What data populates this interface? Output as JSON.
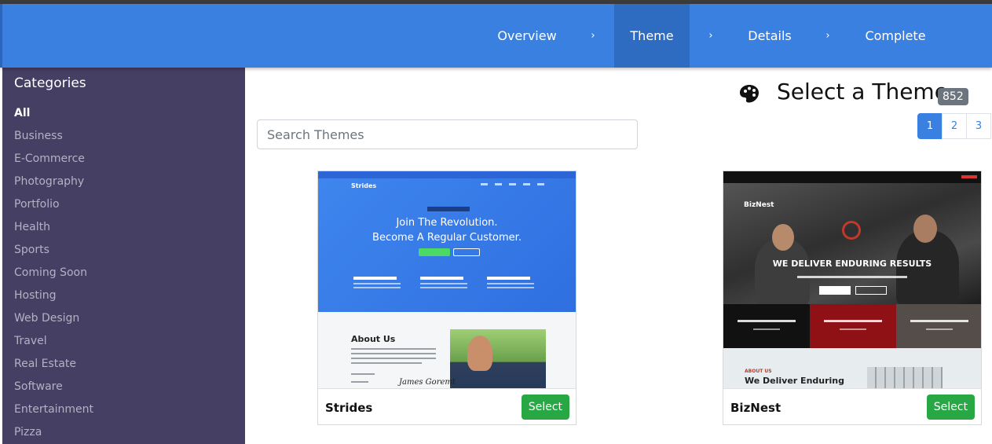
{
  "wizard": {
    "steps": [
      "Overview",
      "Theme",
      "Details",
      "Complete"
    ],
    "separator": "›",
    "active_step": "Theme"
  },
  "sidebar": {
    "heading": "Categories",
    "items": [
      "All",
      "Business",
      "E-Commerce",
      "Photography",
      "Portfolio",
      "Health",
      "Sports",
      "Coming Soon",
      "Hosting",
      "Web Design",
      "Travel",
      "Real Estate",
      "Software",
      "Entertainment",
      "Pizza"
    ],
    "active": "All"
  },
  "header": {
    "title": "Select a Theme",
    "count": "852",
    "icon": "palette-icon"
  },
  "search": {
    "placeholder": "Search Themes",
    "value": ""
  },
  "pagination": {
    "pages": [
      "1",
      "2",
      "3"
    ],
    "current": "1"
  },
  "themes": [
    {
      "name": "Strides",
      "select_label": "Select",
      "preview": {
        "logo": "Strides",
        "headline_1": "Join The Revolution.",
        "headline_2": "Become A Regular Customer.",
        "about_heading": "About Us",
        "signature": "James Goremt"
      }
    },
    {
      "name": "BizNest",
      "select_label": "Select",
      "preview": {
        "logo": "BizNest",
        "headline": "WE DELIVER  ENDURING RESULTS",
        "about_label": "ABOUT US",
        "about_heading": "We Deliver Enduring"
      }
    }
  ],
  "colors": {
    "wizard_bg": "#3a80e0",
    "wizard_active": "#2e6cc2",
    "sidebar_bg": "#453f63",
    "select_button": "#28a745",
    "badge": "#6c757d"
  }
}
